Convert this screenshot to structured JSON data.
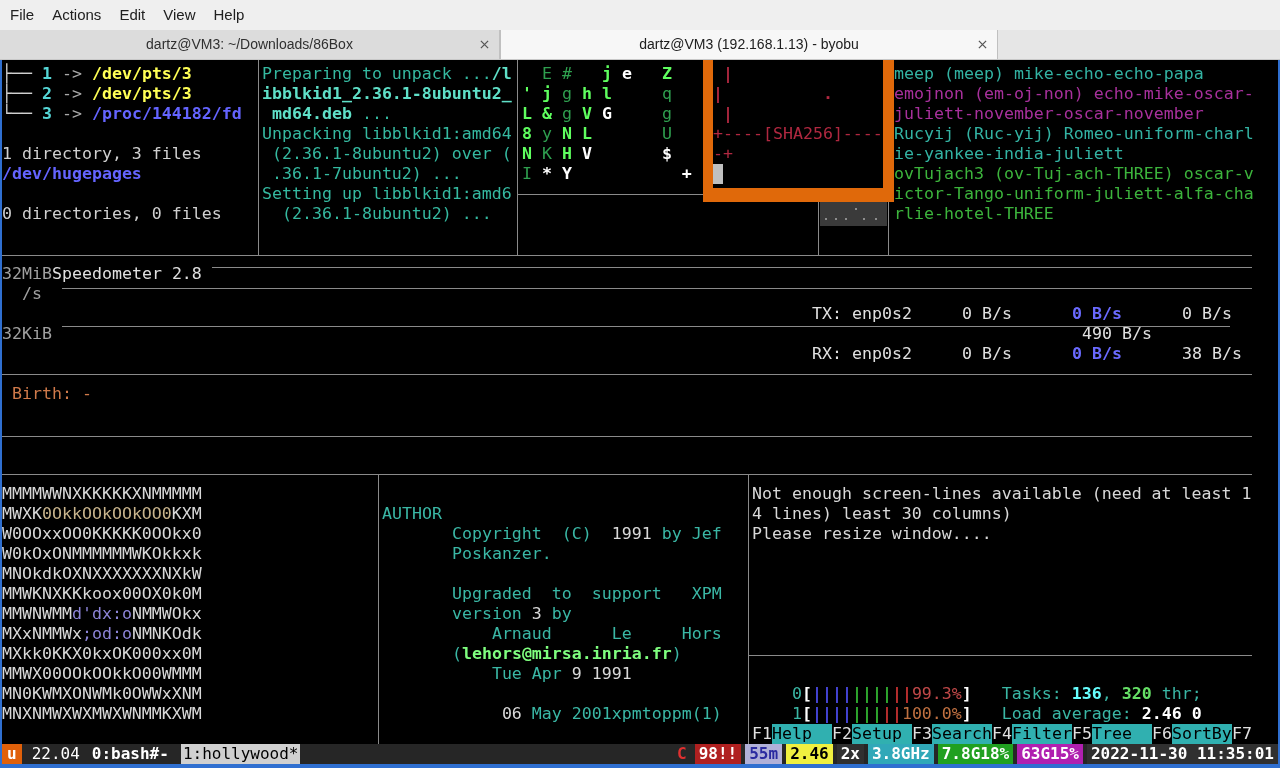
{
  "menu": [
    "File",
    "Actions",
    "Edit",
    "View",
    "Help"
  ],
  "tabs": [
    {
      "title": "dartz@VM3: ~/Downloads/86Box",
      "selected": false
    },
    {
      "title": "dartz@VM3 (192.168.1.13) - byobu",
      "selected": true
    }
  ],
  "panes": [
    {
      "blocks": [
        [
          [
            {
              "text": "├── ",
              "color": "#d0d0d0"
            },
            {
              "text": "1",
              "color": "#55d7d7",
              "bold": true
            },
            {
              "text": " -> ",
              "color": "#a8a8a8",
              "bold": false
            },
            {
              "text": "/dev/pts/3",
              "color": "#ffff55",
              "bold": true
            }
          ],
          [
            {
              "text": "├── ",
              "color": "#d0d0d0"
            },
            {
              "text": "2",
              "color": "#55d7d7",
              "bold": true
            },
            {
              "text": " -> ",
              "color": "#a8a8a8",
              "bold": false
            },
            {
              "text": "/dev/pts/3",
              "color": "#ffff55",
              "bold": true
            }
          ],
          [
            {
              "text": "└── ",
              "color": "#d0d0d0"
            },
            {
              "text": "3",
              "color": "#55d7d7",
              "bold": true
            },
            {
              "text": " -> ",
              "color": "#a8a8a8",
              "bold": false
            },
            {
              "text": "/proc/144182/fd",
              "color": "#6464ff",
              "bold": true
            }
          ]
        ],
        [
          [
            {
              "text": "1 directory, 3 files",
              "color": "#d0d0d0",
              "bold": false
            }
          ],
          [
            {
              "text": "/dev/hugepages",
              "color": "#6464ff",
              "bold": true
            }
          ]
        ],
        [
          [
            {
              "text": "0 directories, 0 files",
              "color": "#d0d0d0",
              "bold": false
            }
          ]
        ]
      ]
    },
    {
      "blocks": [
        [
          [
            {
              "text": "Preparing to unpack ...",
              "color": "#35b9a0",
              "bold": false
            },
            {
              "text": "/l",
              "color": "#5fe0c8",
              "bold": true
            }
          ],
          [
            {
              "text": "ibblkid1_2.36.1-8ubuntu2_",
              "color": "#5fe0c8",
              "bold": true
            }
          ],
          [
            {
              "text": " md64.deb",
              "color": "#5fe0c8",
              "bold": true
            },
            {
              "text": " ...",
              "color": "#35b9a0",
              "bold": false
            }
          ],
          [
            {
              "text": "Unpacking libblkid1:amd64",
              "color": "#35b9a0",
              "bold": false
            }
          ],
          [
            {
              "text": " (2.36.1-8ubuntu2) over (",
              "color": "#35b9a0",
              "bold": false
            }
          ],
          [
            {
              "text": " .36.1-7ubuntu2) ...",
              "color": "#35b9a0",
              "bold": false
            }
          ],
          [
            {
              "text": "Setting up libblkid1:amd6",
              "color": "#35b9a0",
              "bold": false
            }
          ],
          [
            {
              "text": "  (2.36.1-8ubuntu2) ...",
              "color": "#35b9a0",
              "bold": false
            }
          ]
        ]
      ]
    },
    {
      "blocks": [
        [
          [
            {
              "text": "  E #",
              "color": "#2f9f4f",
              "bold": false
            },
            {
              "text": "   j",
              "color": "#5fff5f",
              "bold": true
            },
            {
              "text": " e",
              "color": "#ffffff",
              "bold": true
            },
            {
              "text": "   Z",
              "color": "#5fff5f",
              "bold": true
            }
          ],
          [
            {
              "text": "' j",
              "color": "#5fff5f",
              "bold": true
            },
            {
              "text": " g",
              "color": "#2f9f4f",
              "bold": false
            },
            {
              "text": " h l",
              "color": "#5fff5f",
              "bold": true
            },
            {
              "text": "     q",
              "color": "#2f9f4f",
              "bold": false
            }
          ],
          [
            {
              "text": "L &",
              "color": "#5fff5f",
              "bold": true
            },
            {
              "text": " g",
              "color": "#2f9f4f",
              "bold": false
            },
            {
              "text": " V",
              "color": "#5fff5f",
              "bold": true
            },
            {
              "text": " G",
              "color": "#ffffff",
              "bold": true
            },
            {
              "text": "     g",
              "color": "#2f9f4f",
              "bold": false
            }
          ],
          [
            {
              "text": "8",
              "color": "#5fff5f",
              "bold": true
            },
            {
              "text": " y",
              "color": "#2f9f4f",
              "bold": false
            },
            {
              "text": " N L",
              "color": "#5fff5f",
              "bold": true
            },
            {
              "text": "       U",
              "color": "#2f9f4f",
              "bold": false
            }
          ],
          [
            {
              "text": "N",
              "color": "#5fff5f",
              "bold": true
            },
            {
              "text": " K",
              "color": "#2f9f4f",
              "bold": false
            },
            {
              "text": " H",
              "color": "#5fff5f",
              "bold": true
            },
            {
              "text": " V",
              "color": "#ffffff",
              "bold": true
            },
            {
              "text": "       $",
              "color": "#ffffff",
              "bold": true
            }
          ],
          [
            {
              "text": "I",
              "color": "#2f9f4f",
              "bold": false
            },
            {
              "text": " * Y",
              "color": "#ffffff",
              "bold": true
            },
            {
              "text": "           +",
              "color": "#ffffff",
              "bold": true
            }
          ]
        ]
      ]
    },
    {
      "blocks": [
        [
          [
            {
              "text": "meep (meep) mike-echo-echo-papa",
              "color": "#33b3a3",
              "bold": false
            }
          ],
          [
            {
              "text": "emojnon (em-oj-non) echo-mike-oscar-",
              "color": "#a8309c",
              "bold": false
            }
          ],
          [
            {
              "text": "juliett-november-oscar-november",
              "color": "#a8309c",
              "bold": false
            }
          ],
          [
            {
              "text": "Rucyij (Ruc-yij) Romeo-uniform-charl",
              "color": "#33b3a3",
              "bold": false
            }
          ],
          [
            {
              "text": "ie-yankee-india-juliett",
              "color": "#33b3a3",
              "bold": false
            }
          ],
          [
            {
              "text": "ovTujach3 (ov-Tuj-ach-THREE) oscar-v",
              "color": "#3cb43c",
              "bold": false
            }
          ],
          [
            {
              "text": "ictor-Tango-uniform-juliett-alfa-cha",
              "color": "#3cb43c",
              "bold": false
            }
          ],
          [
            {
              "text": "rlie-hotel-THREE",
              "color": "#3cb43c",
              "bold": false
            }
          ]
        ]
      ]
    },
    {
      "blocks": [
        [
          [
            {
              "text": "MMMMWWNXKKKKKXNMMMMM",
              "color": "#d8d8d8",
              "bold": false
            }
          ],
          [
            {
              "text": "MWXK",
              "color": "#d8d8d8",
              "bold": false
            },
            {
              "text": "0OkkOOkOOkOO0",
              "color": "#c8b48c",
              "bold": false
            },
            {
              "text": "KXM",
              "color": "#d8d8d8",
              "bold": false
            }
          ],
          [
            {
              "text": "W0OOxxOO0KKKKK0OOkx0",
              "color": "#d8d8d8",
              "bold": false
            }
          ],
          [
            {
              "text": "W0kOxONMMMMMMWKOkkxk",
              "color": "#d8d8d8",
              "bold": false
            }
          ],
          [
            {
              "text": "MNOkdkOXNXXXXXXXNXkW",
              "color": "#d8d8d8",
              "bold": false
            }
          ],
          [
            {
              "text": "MMWKNXKKkoox00OX0k0M",
              "color": "#d8d8d8",
              "bold": false
            }
          ],
          [
            {
              "text": "MMWNWMM",
              "color": "#d8d8d8",
              "bold": false
            },
            {
              "text": "d'dx:o",
              "color": "#8c84d8",
              "bold": false
            },
            {
              "text": "NMMWOkx",
              "color": "#d8d8d8",
              "bold": false
            }
          ],
          [
            {
              "text": "MXxNMMWx",
              "color": "#d8d8d8",
              "bold": false
            },
            {
              "text": ";od:o",
              "color": "#8c84d8",
              "bold": false
            },
            {
              "text": "NMNKOdk",
              "color": "#d8d8d8",
              "bold": false
            }
          ],
          [
            {
              "text": "MXkk0KKX0kxOK000xx0M",
              "color": "#d8d8d8",
              "bold": false
            }
          ],
          [
            {
              "text": "MMWX00OOkOOkkO00WMMM",
              "color": "#d8d8d8",
              "bold": false
            }
          ],
          [
            {
              "text": "MN0KWMXONWMk0OWWxXNM",
              "color": "#d8d8d8",
              "bold": false
            }
          ],
          [
            {
              "text": "MNXNMWXWXMWXWNMMKXWM",
              "color": "#d8d8d8",
              "bold": false
            }
          ]
        ]
      ]
    },
    {
      "blocks": [
        [
          [
            {
              "text": "AUTHOR",
              "color": "#3ab7a5",
              "bold": false
            }
          ],
          [
            {
              "text": "       Copyright  (C)  ",
              "color": "#3ab7a5",
              "bold": false
            },
            {
              "text": "1991",
              "color": "#d8d8d8",
              "bold": false
            },
            {
              "text": " by Jef",
              "color": "#3ab7a5",
              "bold": false
            }
          ],
          [
            {
              "text": "       Poskanzer.",
              "color": "#3ab7a5",
              "bold": false
            }
          ]
        ],
        [
          [
            {
              "text": "       Upgraded  to  support   XPM",
              "color": "#3ab7a5",
              "bold": false
            }
          ],
          [
            {
              "text": "       version ",
              "color": "#3ab7a5",
              "bold": false
            },
            {
              "text": "3",
              "color": "#d8d8d8",
              "bold": false
            },
            {
              "text": " by",
              "color": "#3ab7a5",
              "bold": false
            }
          ],
          [
            {
              "text": "           Arnaud      Le     Hors",
              "color": "#3ab7a5",
              "bold": false
            }
          ],
          [
            {
              "text": "       (",
              "color": "#3ab7a5",
              "bold": false
            },
            {
              "text": "lehors@mirsa.inria.fr",
              "color": "#7fff7f",
              "bold": true
            },
            {
              "text": ")",
              "color": "#3ab7a5",
              "bold": false
            }
          ],
          [
            {
              "text": "           Tue Apr ",
              "color": "#3ab7a5",
              "bold": false
            },
            {
              "text": "9 1991",
              "color": "#d8d8d8",
              "bold": false
            }
          ]
        ],
        [
          [
            {
              "text": "            06",
              "color": "#d8d8d8",
              "bold": false
            },
            {
              "text": " May 2001xpmtoppm(1)",
              "color": "#3ab7a5",
              "bold": false
            }
          ]
        ]
      ]
    },
    {
      "blocks": [
        [
          [
            {
              "text": "Not enough screen-lines available (need at least 1",
              "color": "#d8d8d8",
              "bold": false
            }
          ],
          [
            {
              "text": "4 lines) least 30 columns)",
              "color": "#d8d8d8",
              "bold": false
            }
          ],
          [
            {
              "text": "Please resize window....",
              "color": "#d8d8d8",
              "bold": false
            }
          ]
        ]
      ]
    }
  ],
  "randomart": {
    "lines": [
      [
        {
          "text": " |",
          "color": "#b02840",
          "bold": true
        }
      ],
      [
        {
          "text": "|          .",
          "color": "#b02840",
          "bold": true
        }
      ],
      [
        {
          "text": " |",
          "color": "#b02840",
          "bold": true
        }
      ],
      [
        {
          "text": "+----[SHA256]----",
          "color": "#b02840",
          "bold": false
        }
      ],
      [
        {
          "text": "-+",
          "color": "#b02840",
          "bold": false
        }
      ]
    ]
  },
  "speedometer": {
    "title": "Speedometer 2.8",
    "scale_top": "32MiB",
    "unit": "/s",
    "scale_bottom": "32KiB",
    "interfaces": [
      {
        "label": "TX: enp0s2",
        "values": [
          "0 B/s",
          "0 B/s",
          "0 B/s"
        ]
      },
      {
        "label": "RX: enp0s2",
        "values": [
          "0 B/s",
          "0 B/s",
          "38 B/s"
        ]
      }
    ],
    "reading": "490 B/s"
  },
  "birth": "Birth: -",
  "htop": {
    "lines": [
      [
        {
          "text": "    0",
          "color": "#3ab7a5",
          "bold": false
        },
        {
          "text": "[",
          "color": "#ffffff",
          "bold": true
        },
        {
          "text": "||||",
          "color": "#4848e0",
          "bold": true
        },
        {
          "text": "||||",
          "color": "#30b030",
          "bold": true
        },
        {
          "text": "||",
          "color": "#c03030",
          "bold": true
        },
        {
          "text": "99.3%",
          "color": "#c04848",
          "bold": false
        },
        {
          "text": "]",
          "color": "#ffffff",
          "bold": true
        },
        {
          "text": "   Tasks: ",
          "color": "#3ab7a5",
          "bold": false
        },
        {
          "text": "136",
          "color": "#66ffff",
          "bold": true
        },
        {
          "text": ", ",
          "color": "#3ab7a5",
          "bold": false
        },
        {
          "text": "320",
          "color": "#66e066",
          "bold": true
        },
        {
          "text": " thr;",
          "color": "#3ab7a5",
          "bold": false
        }
      ],
      [
        {
          "text": "    1",
          "color": "#3ab7a5",
          "bold": false
        },
        {
          "text": "[",
          "color": "#ffffff",
          "bold": true
        },
        {
          "text": "||||",
          "color": "#4848e0",
          "bold": true
        },
        {
          "text": "|||",
          "color": "#30b030",
          "bold": true
        },
        {
          "text": "||",
          "color": "#c03030",
          "bold": true
        },
        {
          "text": "100.0%",
          "color": "#c07040",
          "bold": false
        },
        {
          "text": "]",
          "color": "#ffffff",
          "bold": true
        },
        {
          "text": "   Load average: ",
          "color": "#3ab7a5",
          "bold": false
        },
        {
          "text": "2.46 0",
          "color": "#ffffff",
          "bold": true
        }
      ]
    ],
    "function_keys": [
      {
        "key": "F1",
        "label": "Help"
      },
      {
        "key": "F2",
        "label": "Setup"
      },
      {
        "key": "F3",
        "label": "Search"
      },
      {
        "key": "F4",
        "label": "Filter"
      },
      {
        "key": "F5",
        "label": "Tree"
      },
      {
        "key": "F6",
        "label": "SortBy"
      },
      {
        "key": "F7"
      }
    ]
  },
  "status_bar": {
    "left": [
      {
        "text": "u",
        "color": "#e0600a",
        "kind": "accent"
      },
      {
        "text": "22.04",
        "color": "#262626",
        "kind": "plain"
      }
    ],
    "windows": [
      {
        "label": "0:bash#-",
        "selected": false
      },
      {
        "label": "1:hollywood*",
        "selected": true
      }
    ],
    "right": [
      {
        "text": "C",
        "color": "#262626",
        "kind": "warning"
      },
      {
        "text": "98!!",
        "color": "#b02020",
        "kind": "plain"
      },
      {
        "text": "55m",
        "color": "#b0b0d8",
        "kind": "dim"
      },
      {
        "text": "2.46",
        "color": "#f0f040",
        "kind": "highlight"
      },
      {
        "text": "2x",
        "color": "#303030",
        "kind": "plain"
      },
      {
        "text": "3.8GHz",
        "color": "#30a8b8",
        "kind": "plain"
      },
      {
        "text": "7.8G18%",
        "color": "#20a020",
        "kind": "plain"
      },
      {
        "text": "63G15%",
        "color": "#b020b0",
        "kind": "plain"
      },
      {
        "text": "2022-11-30 11:35:01",
        "color": "#303030",
        "kind": "plain"
      }
    ]
  }
}
